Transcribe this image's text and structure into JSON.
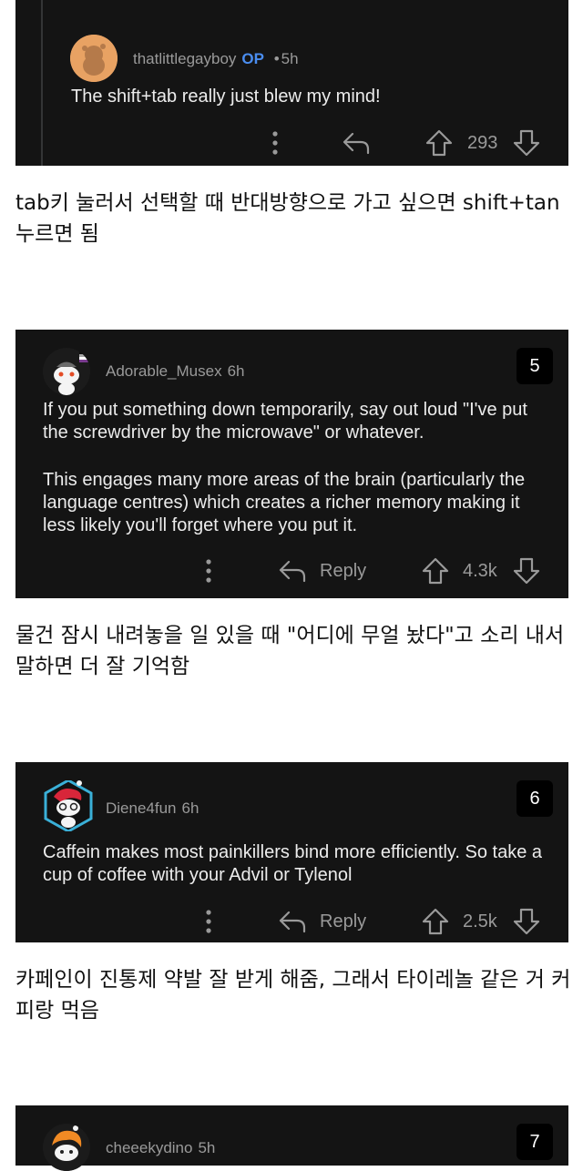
{
  "comments": [
    {
      "username": "thatlittlegayboy",
      "op_badge": "OP",
      "separator": "•",
      "time": "5h",
      "body": [
        "The shift+tab really just blew my mind!"
      ],
      "score": "293",
      "avatar_color": "#e8a263"
    },
    {
      "rank": "5",
      "username": "Adorable_Musex",
      "time": "6h",
      "body": [
        "If you put something down temporarily, say out loud \"I've put the screwdriver by the microwave\" or whatever.",
        "This engages many more areas of the brain (particularly the language centres) which creates a richer memory making it less likely you'll forget where you put it."
      ],
      "reply_label": "Reply",
      "score": "4.3k"
    },
    {
      "rank": "6",
      "username": "Diene4fun",
      "time": "6h",
      "body": [
        "Caffein makes most painkillers bind more efficiently. So take a cup of coffee with your Advil or Tylenol"
      ],
      "reply_label": "Reply",
      "score": "2.5k",
      "avatar_color": "#2c7fa8"
    },
    {
      "rank": "7",
      "username": "cheeekydino",
      "time": "5h"
    }
  ],
  "translations": [
    "tab키 눌러서 선택할 때 반대방향으로 가고 싶으면 shift+tan 누르면 됨",
    "물건 잠시 내려놓을 일 있을 때 \"어디에 무얼 놨다\"고 소리 내서 말하면 더 잘 기억함",
    "카페인이 진통제 약발 잘 받게 해줌, 그래서 타이레놀 같은 거 커피랑 먹음"
  ]
}
